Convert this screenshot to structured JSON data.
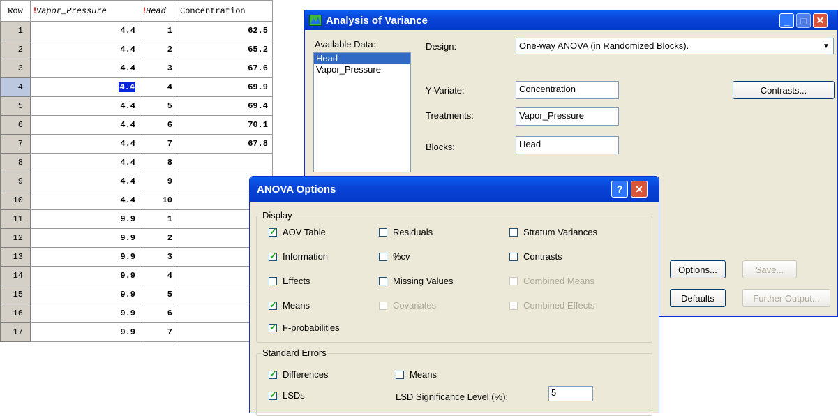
{
  "sheet": {
    "headers": {
      "row": "Row",
      "col1": "Vapor_Pressure",
      "col2": "Head",
      "col3": "Concentration"
    },
    "rows": [
      {
        "row": "1",
        "vp": "4.4",
        "head": "1",
        "conc": "62.5"
      },
      {
        "row": "2",
        "vp": "4.4",
        "head": "2",
        "conc": "65.2"
      },
      {
        "row": "3",
        "vp": "4.4",
        "head": "3",
        "conc": "67.6"
      },
      {
        "row": "4",
        "vp": "4.4",
        "head": "4",
        "conc": "69.9"
      },
      {
        "row": "5",
        "vp": "4.4",
        "head": "5",
        "conc": "69.4"
      },
      {
        "row": "6",
        "vp": "4.4",
        "head": "6",
        "conc": "70.1"
      },
      {
        "row": "7",
        "vp": "4.4",
        "head": "7",
        "conc": "67.8"
      },
      {
        "row": "8",
        "vp": "4.4",
        "head": "8",
        "conc": ""
      },
      {
        "row": "9",
        "vp": "4.4",
        "head": "9",
        "conc": ""
      },
      {
        "row": "10",
        "vp": "4.4",
        "head": "10",
        "conc": ""
      },
      {
        "row": "11",
        "vp": "9.9",
        "head": "1",
        "conc": ""
      },
      {
        "row": "12",
        "vp": "9.9",
        "head": "2",
        "conc": ""
      },
      {
        "row": "13",
        "vp": "9.9",
        "head": "3",
        "conc": ""
      },
      {
        "row": "14",
        "vp": "9.9",
        "head": "4",
        "conc": ""
      },
      {
        "row": "15",
        "vp": "9.9",
        "head": "5",
        "conc": ""
      },
      {
        "row": "16",
        "vp": "9.9",
        "head": "6",
        "conc": ""
      },
      {
        "row": "17",
        "vp": "9.9",
        "head": "7",
        "conc": ""
      }
    ]
  },
  "anova": {
    "title": "Analysis of Variance",
    "available_data_label": "Available Data:",
    "available_items": [
      "Head",
      "Vapor_Pressure"
    ],
    "design_label": "Design:",
    "design_value": "One-way ANOVA (in Randomized Blocks).",
    "yvariate_label": "Y-Variate:",
    "yvariate_value": "Concentration",
    "treatments_label": "Treatments:",
    "treatments_value": "Vapor_Pressure",
    "blocks_label": "Blocks:",
    "blocks_value": "Head",
    "contrasts_btn": "Contrasts...",
    "options_btn": "Options...",
    "save_btn": "Save...",
    "defaults_btn": "Defaults",
    "further_btn": "Further Output..."
  },
  "options": {
    "title": "ANOVA Options",
    "display_group": "Display",
    "aov_table": "AOV Table",
    "residuals": "Residuals",
    "stratum": "Stratum Variances",
    "information": "Information",
    "cv": "%cv",
    "contrasts": "Contrasts",
    "effects": "Effects",
    "missing": "Missing Values",
    "combined_means": "Combined Means",
    "means": "Means",
    "covariates": "Covariates",
    "combined_effects": "Combined Effects",
    "fprob": "F-probabilities",
    "se_group": "Standard Errors",
    "differences": "Differences",
    "se_means": "Means",
    "lsds": "LSDs",
    "lsd_level_label": "LSD Significance Level (%):",
    "lsd_level_value": "5"
  }
}
